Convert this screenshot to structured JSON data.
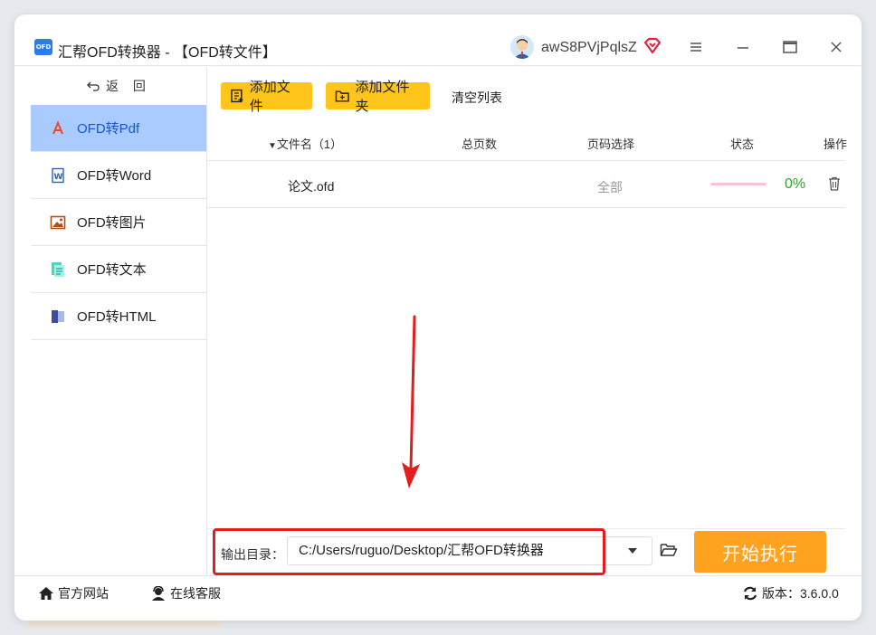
{
  "window": {
    "logo_text": "OFD",
    "title": "汇帮OFD转换器 - 【OFD转文件】",
    "username": "awS8PVjPqlsZ"
  },
  "sidebar": {
    "back_label": "返 回",
    "items": [
      {
        "label": "OFD转Pdf",
        "icon": "pdf-icon",
        "active": true
      },
      {
        "label": "OFD转Word",
        "icon": "word-icon"
      },
      {
        "label": "OFD转图片",
        "icon": "image-icon"
      },
      {
        "label": "OFD转文本",
        "icon": "text-icon"
      },
      {
        "label": "OFD转HTML",
        "icon": "html-icon"
      }
    ]
  },
  "toolbar": {
    "add_file": "添加文件",
    "add_folder": "添加文件夹",
    "clear_list": "清空列表"
  },
  "table": {
    "headers": {
      "filename": "文件名（1）",
      "pages": "总页数",
      "page_select": "页码选择",
      "status": "状态",
      "action": "操作"
    },
    "rows": [
      {
        "filename": "论文.ofd",
        "pages": "",
        "page_select": "全部",
        "progress": "0%"
      }
    ]
  },
  "output": {
    "label": "输出目录：",
    "path": "C:/Users/ruguo/Desktop/汇帮OFD转换器"
  },
  "start_button": "开始执行",
  "footer": {
    "website": "官方网站",
    "support": "在线客服",
    "version": "版本：3.6.0.0"
  },
  "colors": {
    "accent_yellow": "#ffc51a",
    "start_orange": "#ffa21f",
    "active_nav": "#a9cbff",
    "progress_green": "#2aa52a",
    "annotation_red": "#e31d1d"
  }
}
